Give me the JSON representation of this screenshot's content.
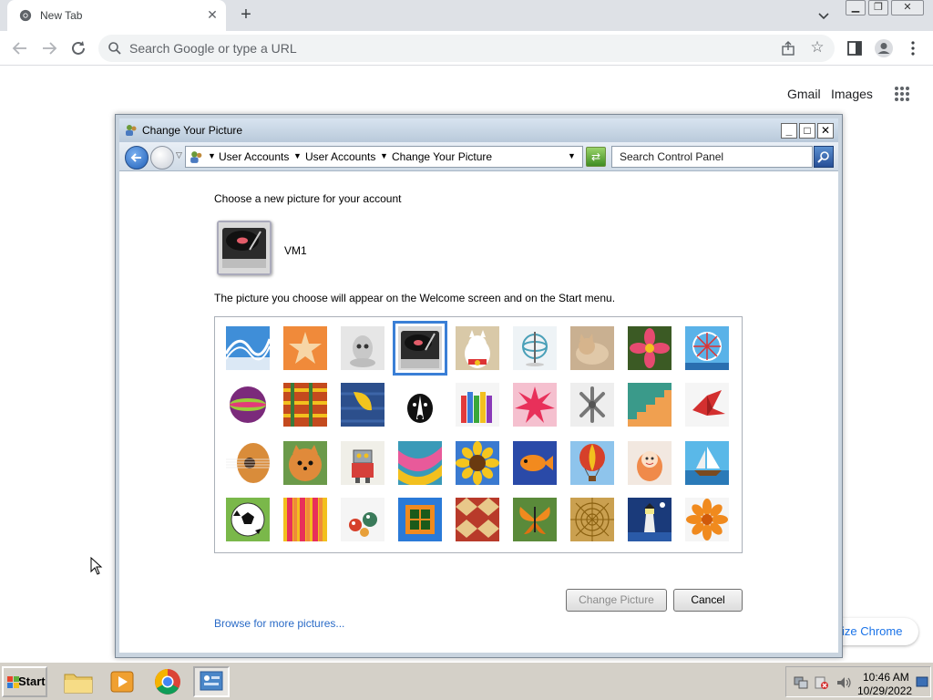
{
  "browser": {
    "tab_title": "New Tab",
    "omnibox_placeholder": "Search Google or type a URL",
    "ntp_links": {
      "gmail": "Gmail",
      "images": "Images"
    },
    "customize_label": "ize Chrome"
  },
  "dialog": {
    "title": "Change Your Picture",
    "breadcrumbs": [
      "User Accounts",
      "User Accounts",
      "Change Your Picture"
    ],
    "search_placeholder": "Search Control Panel",
    "heading": "Choose a new picture for your account",
    "username": "VM1",
    "description": "The picture you choose will appear on the Welcome screen and on the Start menu.",
    "pictures": [
      "rollercoaster",
      "starfish",
      "robot-dog",
      "turntable",
      "lucky-cat",
      "gyroscope",
      "kitten",
      "flower-pink",
      "ferris-wheel",
      "ball",
      "fabric",
      "leaf",
      "border-collie",
      "crayons",
      "star-flower",
      "jacks",
      "stairs",
      "origami-crane",
      "guitar",
      "pomeranian",
      "toy-robot",
      "scarf",
      "sunflower",
      "tropical-fish",
      "hot-air-balloon",
      "doll",
      "sailboat",
      "soccer-ball",
      "stripes",
      "marbles",
      "window",
      "rug",
      "butterfly",
      "wicker",
      "lighthouse",
      "orange-flower"
    ],
    "selected_picture": "turntable",
    "browse_link": "Browse for more pictures...",
    "change_button": "Change Picture",
    "cancel_button": "Cancel"
  },
  "taskbar": {
    "start_label": "Start",
    "time": "10:46 AM",
    "date": "10/29/2022"
  }
}
